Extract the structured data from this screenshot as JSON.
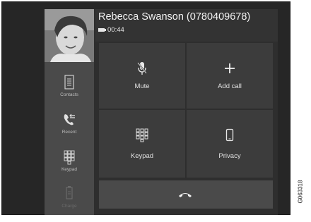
{
  "call": {
    "caller": "Rebecca Swanson (0780409678)",
    "duration": "00:44"
  },
  "sidebar": {
    "items": [
      {
        "label": "Contacts",
        "icon": "contacts-icon"
      },
      {
        "label": "Recent",
        "icon": "recent-calls-icon"
      },
      {
        "label": "Keypad",
        "icon": "keypad-icon"
      },
      {
        "label": "Charge",
        "icon": "charge-icon"
      }
    ]
  },
  "actions": {
    "mute": "Mute",
    "add_call": "Add call",
    "keypad": "Keypad",
    "privacy": "Privacy"
  },
  "figure_code": "G063318",
  "colors": {
    "frame": "#262626",
    "sidebar": "#4a4a4a",
    "tile": "#3c3c3c",
    "end_bar": "#4a4a4a",
    "text": "#e8e8e8"
  }
}
